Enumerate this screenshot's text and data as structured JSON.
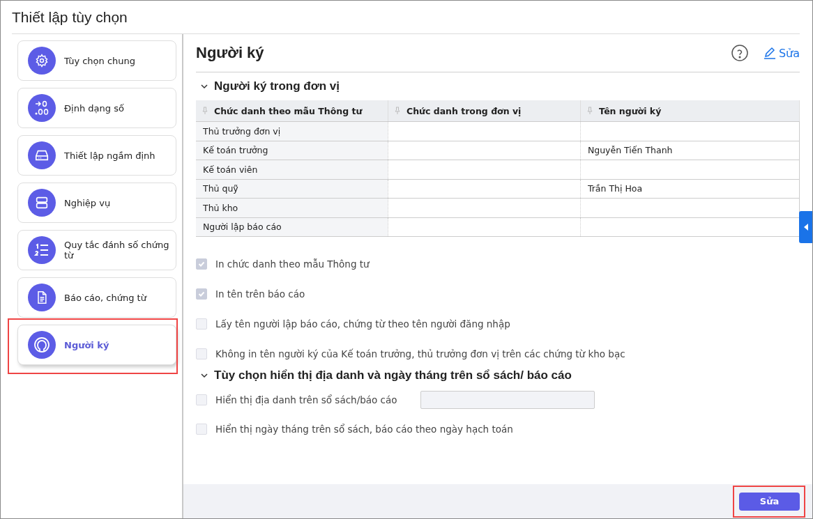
{
  "window": {
    "title": "Thiết lập tùy chọn"
  },
  "sidebar": {
    "items": [
      {
        "label": "Tùy chọn chung",
        "selected": false,
        "highlighted": false
      },
      {
        "label": "Định dạng số",
        "selected": false,
        "highlighted": false
      },
      {
        "label": "Thiết lập ngầm định",
        "selected": false,
        "highlighted": false
      },
      {
        "label": "Nghiệp vụ",
        "selected": false,
        "highlighted": false
      },
      {
        "label": "Quy tắc đánh số chứng từ",
        "selected": false,
        "highlighted": false
      },
      {
        "label": "Báo cáo, chứng từ",
        "selected": false,
        "highlighted": false
      },
      {
        "label": "Người ký",
        "selected": true,
        "highlighted": true
      }
    ]
  },
  "page": {
    "title": "Người ký",
    "edit_link": "Sửa"
  },
  "section_1": {
    "title": "Người ký trong đơn vị",
    "expanded": true,
    "table": {
      "columns": [
        "Chức danh theo mẫu Thông tư",
        "Chức danh trong đơn vị",
        "Tên người ký"
      ],
      "rows": [
        [
          "Thủ trưởng đơn vị",
          "",
          ""
        ],
        [
          "Kế toán trưởng",
          "",
          "Nguyễn Tiến Thanh"
        ],
        [
          "Kế toán viên",
          "",
          ""
        ],
        [
          "Thủ quỹ",
          "",
          "Trần Thị Hoa"
        ],
        [
          "Thủ kho",
          "",
          ""
        ],
        [
          "Người lập báo cáo",
          "",
          ""
        ]
      ]
    },
    "options": [
      {
        "label": "In chức danh theo mẫu Thông tư",
        "checked": true,
        "disabled": true
      },
      {
        "label": "In tên trên báo cáo",
        "checked": true,
        "disabled": true
      },
      {
        "label": "Lấy tên người lập báo cáo, chứng từ theo tên người đăng nhập",
        "checked": false,
        "disabled": true
      },
      {
        "label": "Không in tên người ký của Kế toán trưởng, thủ trưởng đơn vị trên các chứng từ kho bạc",
        "checked": false,
        "disabled": true
      }
    ]
  },
  "section_2": {
    "title": "Tùy chọn hiển thị địa danh và ngày tháng trên sổ sách/ báo cáo",
    "expanded": true,
    "options": [
      {
        "label": "Hiển thị địa danh trên sổ sách/báo cáo",
        "checked": false,
        "disabled": true,
        "kind": "with_input"
      },
      {
        "label": "Hiển thị ngày tháng trên sổ sách, báo cáo theo ngày hạch toán",
        "checked": false,
        "disabled": true,
        "kind": "plain"
      }
    ]
  },
  "footer": {
    "button": "Sửa",
    "highlighted": true
  }
}
